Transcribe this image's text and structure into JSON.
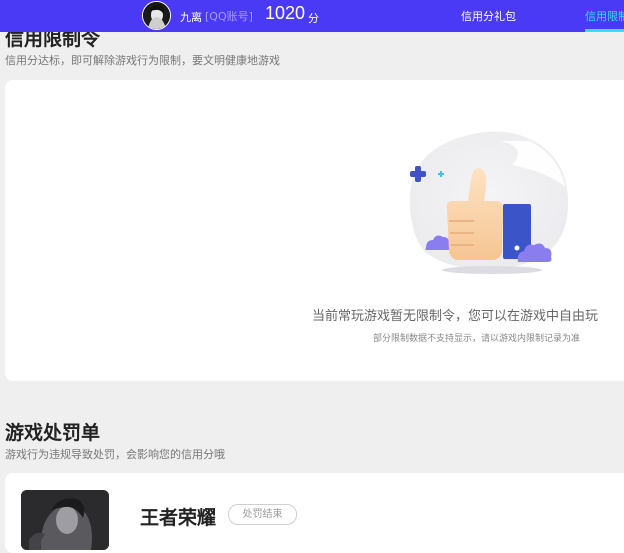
{
  "header": {
    "username": "九离",
    "account_type": "[QQ账号]",
    "score": "1020",
    "score_unit": "分",
    "nav": {
      "gift": "信用分礼包",
      "restriction": "信用限制"
    }
  },
  "restriction_section": {
    "title": "信用限制令",
    "subtitle": "信用分达标，即可解除游戏行为限制，要文明健康地游戏",
    "empty_main": "当前常玩游戏暂无限制令，您可以在游戏中自由玩",
    "empty_sub": "部分限制数据不支持显示，请以游戏内限制记录为准"
  },
  "penalty_section": {
    "title": "游戏处罚单",
    "subtitle": "游戏行为违规导致处罚，会影响您的信用分哦",
    "items": [
      {
        "game": "王者荣耀",
        "status": "处罚结束"
      }
    ]
  },
  "colors": {
    "header_bg": "#4b3af5",
    "active_nav": "#34e0f3",
    "page_bg": "#efefef"
  }
}
